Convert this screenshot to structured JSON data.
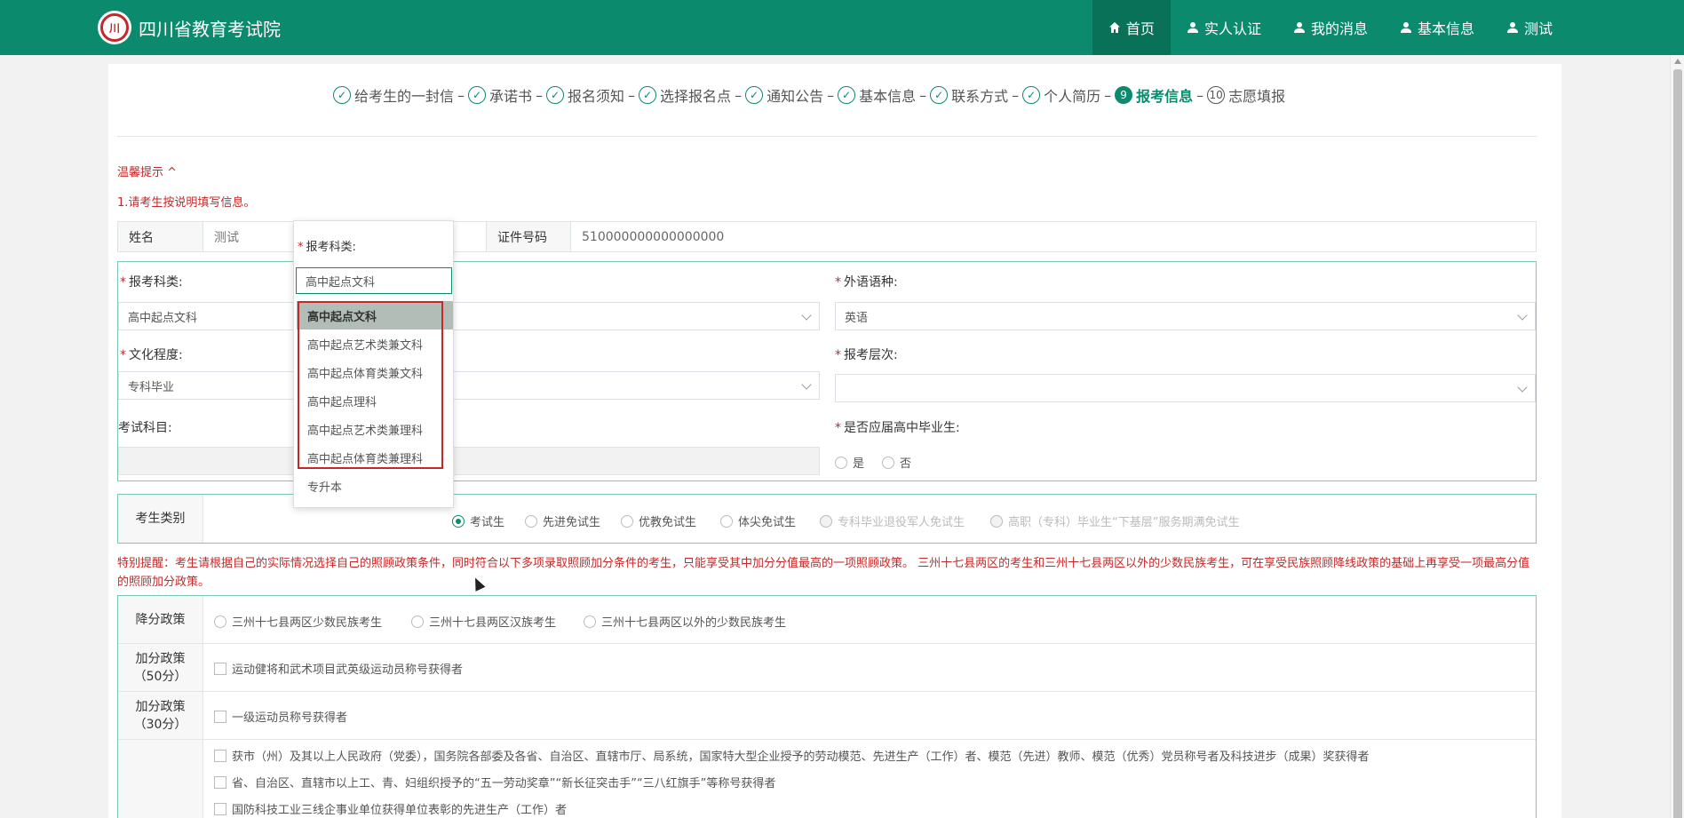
{
  "header": {
    "title": "四川省教育考试院",
    "nav": [
      {
        "label": "首页",
        "icon": "home-icon"
      },
      {
        "label": "实人认证",
        "icon": "user-icon"
      },
      {
        "label": "我的消息",
        "icon": "user-icon"
      },
      {
        "label": "基本信息",
        "icon": "user-icon"
      },
      {
        "label": "测试",
        "icon": "user-icon"
      }
    ]
  },
  "steps": [
    {
      "label": "给考生的一封信",
      "mark": "✓"
    },
    {
      "label": "承诺书",
      "mark": "✓"
    },
    {
      "label": "报名须知",
      "mark": "✓"
    },
    {
      "label": "选择报名点",
      "mark": "✓"
    },
    {
      "label": "通知公告",
      "mark": "✓"
    },
    {
      "label": "基本信息",
      "mark": "✓"
    },
    {
      "label": "联系方式",
      "mark": "✓"
    },
    {
      "label": "个人简历",
      "mark": "✓"
    },
    {
      "label": "报考信息",
      "mark": "9"
    },
    {
      "label": "志愿填报",
      "mark": "10"
    }
  ],
  "tips": {
    "title": "温馨提示 ^",
    "line1": "1.请考生按说明填写信息。"
  },
  "identity": {
    "name_label": "姓名",
    "name_value": "测试",
    "id_label": "证件号码",
    "id_value": "510000000000000000"
  },
  "form": {
    "subject_label": "报考科类:",
    "subject_value": "高中起点文科",
    "language_label": "外语语种:",
    "language_value": "英语",
    "education_label": "文化程度:",
    "education_value": "专科毕业",
    "level_label": "报考层次:",
    "level_value": "",
    "exam_subjects_label": "考试科目:",
    "graduate_label": "是否应届高中毕业生:",
    "yes": "是",
    "no": "否"
  },
  "category": {
    "label": "考生类别",
    "options": [
      "考试生",
      "先进免试生",
      "优教免试生",
      "体尖免试生",
      "专科毕业退役军人免试生",
      "高职（专科）毕业生“下基层”服务期满免试生"
    ]
  },
  "warning": "特别提醒：考生请根据自己的实际情况选择自己的照顾政策条件，同时符合以下多项录取照顾加分条件的考生，只能享受其中加分分值最高的一项照顾政策。 三州十七县两区的考生和三州十七县两区以外的少数民族考生，可在享受民族照顾降线政策的基础上再享受一项最高分值的照顾加分政策。",
  "policy": {
    "reduce_label": "降分政策",
    "reduce_options": [
      "三州十七县两区少数民族考生",
      "三州十七县两区汉族考生",
      "三州十七县两区以外的少数民族考生"
    ],
    "add50_label1": "加分政策",
    "add50_label2": "（50分）",
    "add50_option": "运动健将和武术项目武英级运动员称号获得者",
    "add30_label1": "加分政策",
    "add30_label2": "（30分）",
    "add30_option": "一级运动员称号获得者",
    "more_options": [
      "获市（州）及其以上人民政府（党委），国务院各部委及各省、自治区、直辖市厅、局系统，国家特大型企业授予的劳动模范、先进生产（工作）者、模范（先进）教师、模范（优秀）党员称号者及科技进步（成果）奖获得者",
      "省、自治区、直辖市以上工、青、妇组织授予的“五一劳动奖章”“新长征突击手”“三八红旗手”等称号获得者",
      "国防科技工业三线企事业单位获得单位表彰的先进生产（工作）者"
    ]
  },
  "dropdown": {
    "label": "报考科类:",
    "input_value": "高中起点文科",
    "options": [
      "高中起点文科",
      "高中起点艺术类兼文科",
      "高中起点体育类兼文科",
      "高中起点理科",
      "高中起点艺术类兼理科",
      "高中起点体育类兼理科",
      "专升本"
    ],
    "selected_index": 0
  },
  "colors": {
    "primary": "#0c8a6e",
    "warning": "#c62828"
  }
}
